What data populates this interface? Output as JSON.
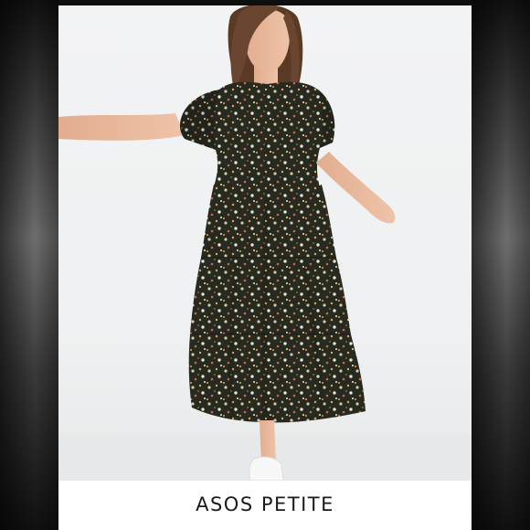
{
  "listing": {
    "brand_caption": "ASOS PETITE"
  },
  "photo": {
    "subject": "model-in-floral-tiered-midi-dress",
    "colors": {
      "background": "#eef0f1",
      "dress": "#2b2f24",
      "skin": "#e8b89c",
      "hair": "#5a3a24",
      "shoes": "#f5f5f5"
    }
  }
}
